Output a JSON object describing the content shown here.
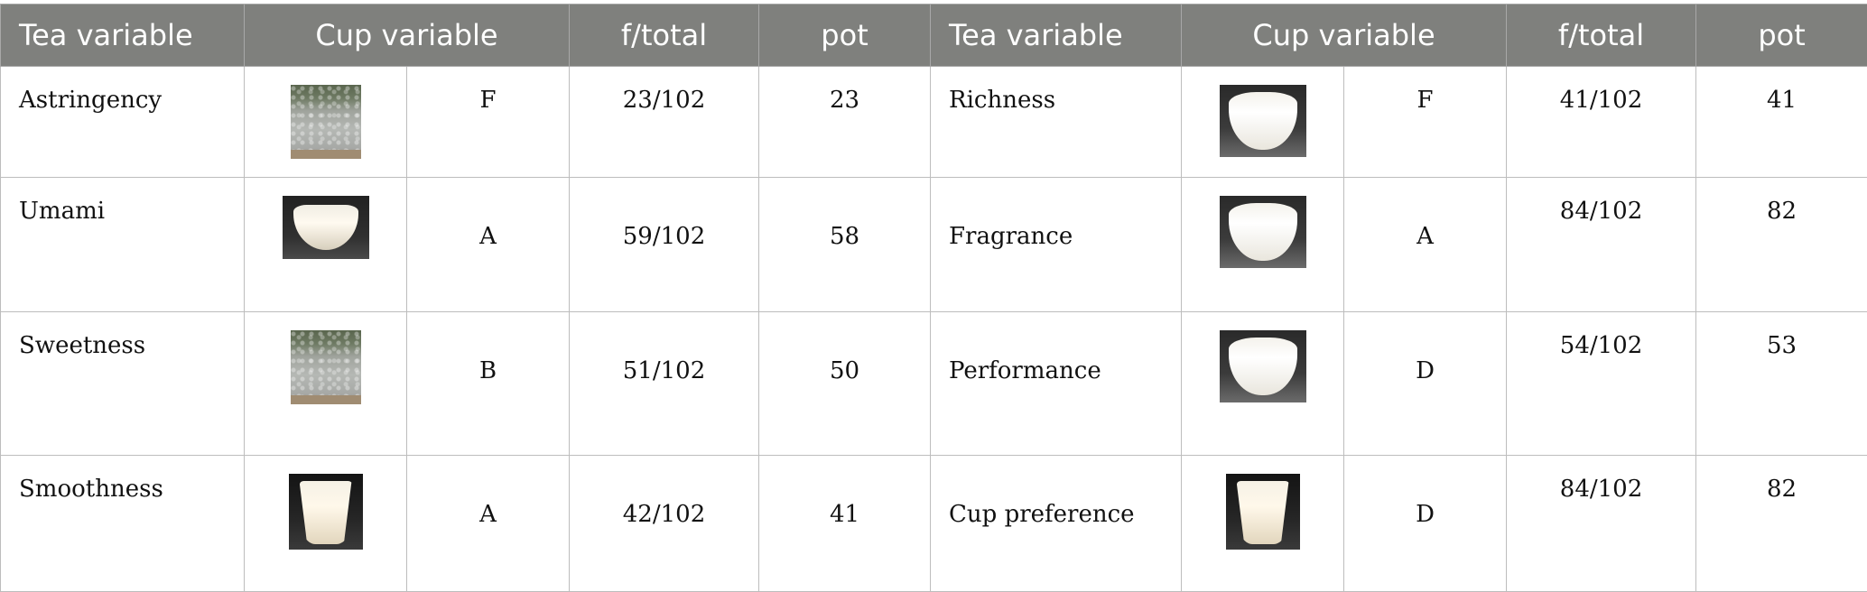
{
  "headers": [
    "Tea variable",
    "Cup variable",
    "f/total",
    "pot",
    "Tea variable",
    "Cup variable",
    "f/total",
    "pot"
  ],
  "rows": [
    {
      "left": {
        "tea": "Astringency",
        "cup": "F",
        "f_total": "23/102",
        "pot": "23"
      },
      "right": {
        "tea": "Richness",
        "cup": "F",
        "f_total": "41/102",
        "pot": "41"
      }
    },
    {
      "left": {
        "tea": "Umami",
        "cup": "A",
        "f_total": "59/102",
        "pot": "58"
      },
      "right": {
        "tea": "Fragrance",
        "cup": "A",
        "f_total": "84/102",
        "pot": "82"
      }
    },
    {
      "left": {
        "tea": "Sweetness",
        "cup": "B",
        "f_total": "51/102",
        "pot": "50"
      },
      "right": {
        "tea": "Performance",
        "cup": "D",
        "f_total": "54/102",
        "pot": "53"
      }
    },
    {
      "left": {
        "tea": "Smoothness",
        "cup": "A",
        "f_total": "42/102",
        "pot": "41"
      },
      "right": {
        "tea": "Cup preference",
        "cup": "D",
        "f_total": "84/102",
        "pot": "82"
      }
    }
  ],
  "colors": {
    "header_bg": "#7f807d",
    "header_text": "#ffffff",
    "grid": "#bdbdbd"
  }
}
